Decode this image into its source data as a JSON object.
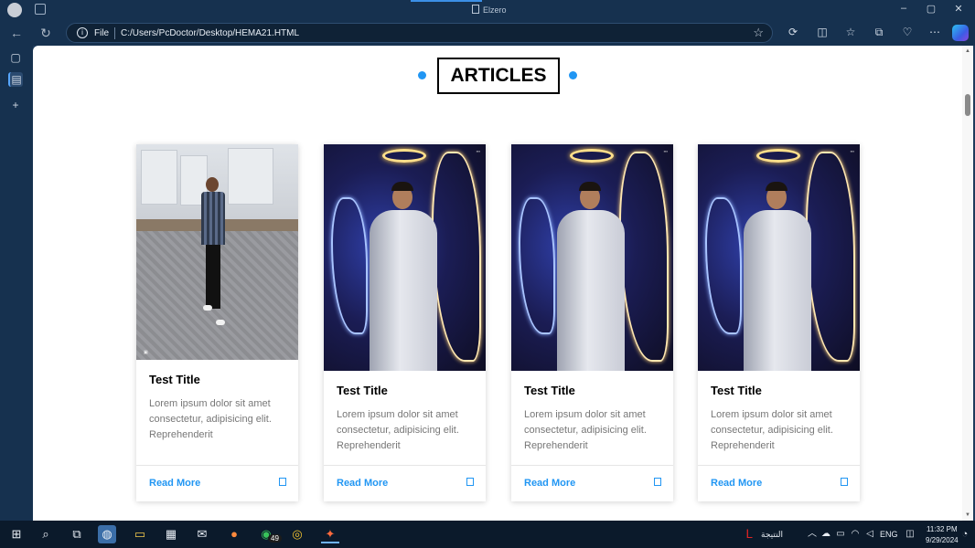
{
  "browser": {
    "window_title": "Elzero",
    "address": {
      "scheme_label": "File",
      "url": "C:/Users/PcDoctor/Desktop/HEMA21.HTML"
    }
  },
  "page": {
    "heading": "ARTICLES",
    "accent_color": "#2196f3",
    "cards": [
      {
        "image": "man-standing-street-photo",
        "title": "Test Title",
        "text": "Lorem ipsum dolor sit amet consectetur, adipisicing elit. Reprehenderit",
        "link": "Read More"
      },
      {
        "image": "man-neon-wings-photo",
        "title": "Test Title",
        "text": "Lorem ipsum dolor sit amet consectetur, adipisicing elit. Reprehenderit",
        "link": "Read More"
      },
      {
        "image": "man-neon-wings-photo",
        "title": "Test Title",
        "text": "Lorem ipsum dolor sit amet consectetur, adipisicing elit. Reprehenderit",
        "link": "Read More"
      },
      {
        "image": "man-neon-wings-photo",
        "title": "Test Title",
        "text": "Lorem ipsum dolor sit amet consectetur, adipisicing elit. Reprehenderit",
        "link": "Read More"
      }
    ]
  },
  "taskbar": {
    "whatsapp_badge": "49",
    "search_label": "النتيجة",
    "language": "ENG",
    "time": "11:32 PM",
    "date": "9/29/2024"
  }
}
